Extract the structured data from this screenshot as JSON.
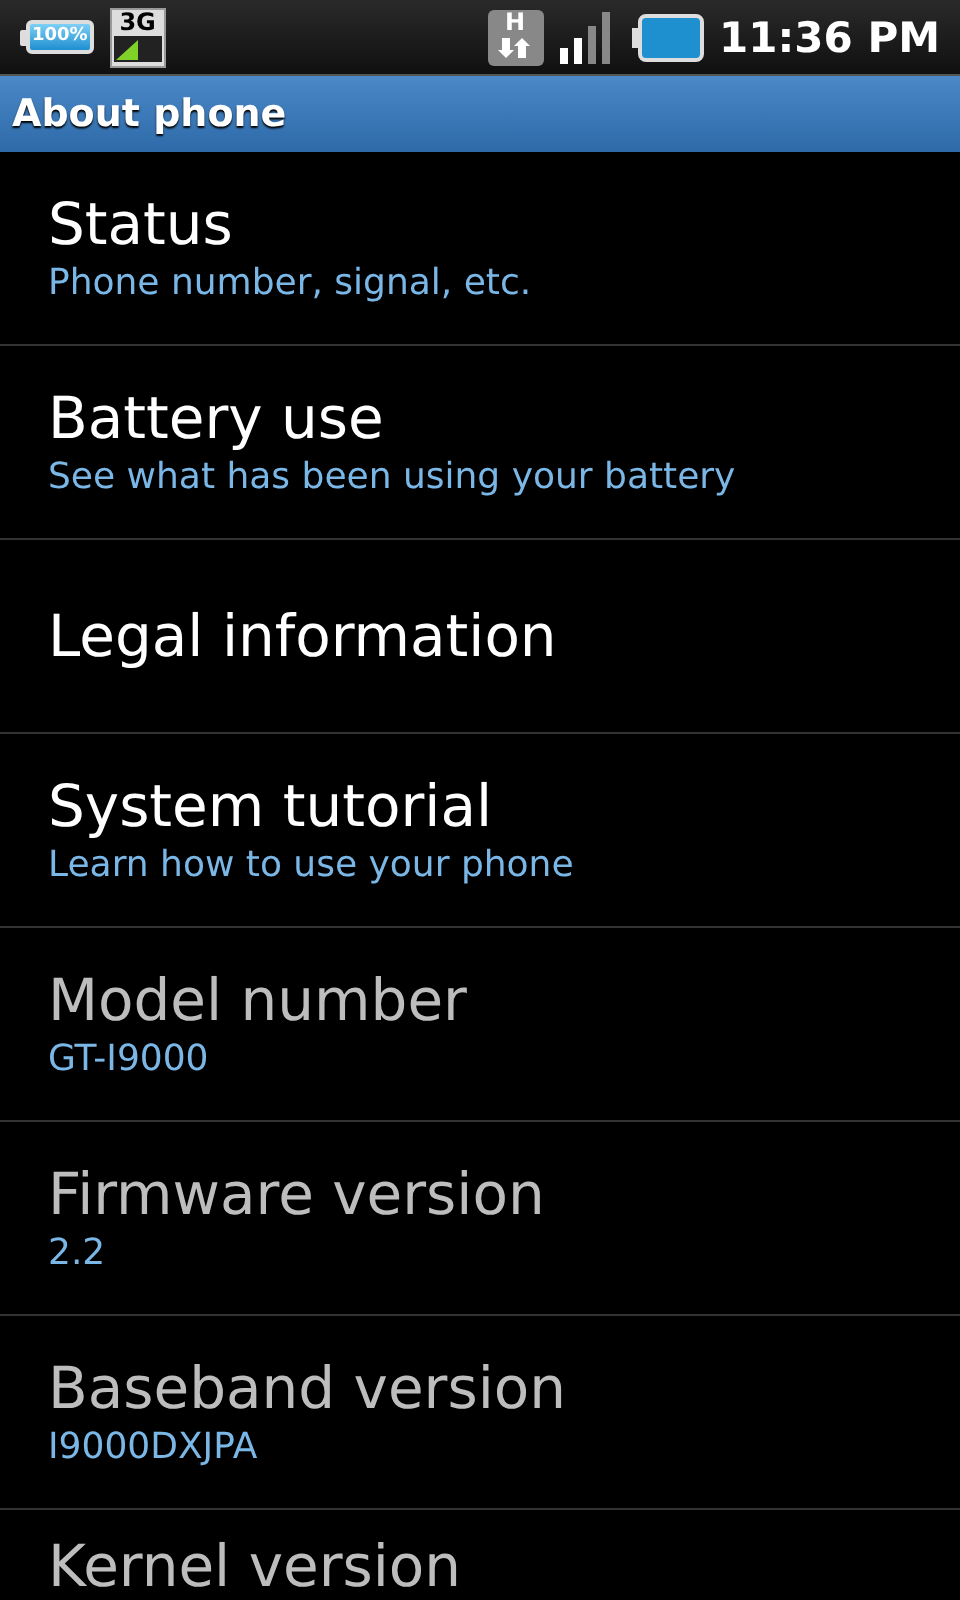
{
  "status_bar": {
    "battery_label": "100%",
    "network": "3G",
    "data_type": "H",
    "time": "11:36 PM"
  },
  "title_bar": {
    "title": "About phone"
  },
  "items": [
    {
      "title": "Status",
      "summary": "Phone number, signal, etc.",
      "disabled": false
    },
    {
      "title": "Battery use",
      "summary": "See what has been using your battery",
      "disabled": false
    },
    {
      "title": "Legal information",
      "disabled": false
    },
    {
      "title": "System tutorial",
      "summary": "Learn how to use your phone",
      "disabled": false
    },
    {
      "title": "Model number",
      "summary": "GT-I9000",
      "disabled": true
    },
    {
      "title": "Firmware version",
      "summary": "2.2",
      "disabled": true
    },
    {
      "title": "Baseband version",
      "summary": "I9000DXJPA",
      "disabled": true
    },
    {
      "title": "Kernel version",
      "disabled": true
    }
  ]
}
